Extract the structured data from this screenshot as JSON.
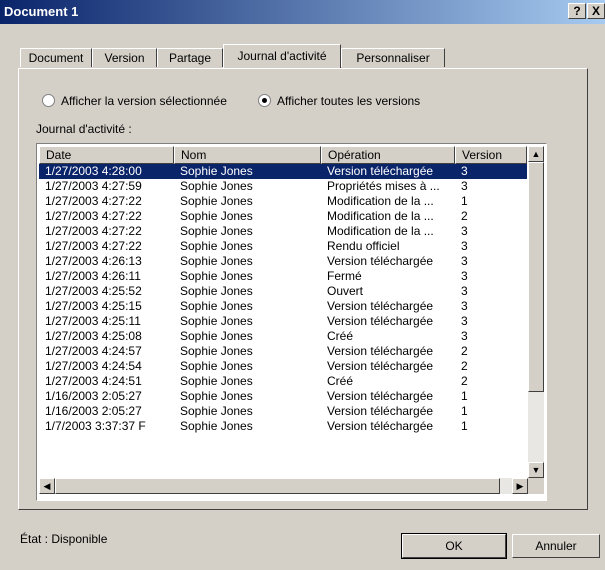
{
  "window": {
    "title": "Document 1",
    "help": "?",
    "close": "X"
  },
  "tabs": [
    "Document",
    "Version",
    "Partage",
    "Journal d'activité",
    "Personnaliser"
  ],
  "options": {
    "radio_selected": "Afficher la version sélectionnée",
    "radio_all": "Afficher toutes les versions"
  },
  "log_label": "Journal d'activité :",
  "table": {
    "columns": [
      "Date",
      "Nom",
      "Opération",
      "Version"
    ],
    "rows": [
      [
        "1/27/2003 4:28:00",
        "Sophie Jones",
        "Version téléchargée",
        "3"
      ],
      [
        "1/27/2003 4:27:59",
        "Sophie Jones",
        "Propriétés mises à ...",
        "3"
      ],
      [
        "1/27/2003 4:27:22",
        "Sophie Jones",
        "Modification de la ...",
        "1"
      ],
      [
        "1/27/2003 4:27:22",
        "Sophie Jones",
        "Modification de la ...",
        "2"
      ],
      [
        "1/27/2003 4:27:22",
        "Sophie Jones",
        "Modification de la ...",
        "3"
      ],
      [
        "1/27/2003 4:27:22",
        "Sophie Jones",
        "Rendu officiel",
        "3"
      ],
      [
        "1/27/2003 4:26:13",
        "Sophie Jones",
        "Version téléchargée",
        "3"
      ],
      [
        "1/27/2003 4:26:11",
        "Sophie Jones",
        "Fermé",
        "3"
      ],
      [
        "1/27/2003 4:25:52",
        "Sophie Jones",
        "Ouvert",
        "3"
      ],
      [
        "1/27/2003 4:25:15",
        "Sophie Jones",
        "Version téléchargée",
        "3"
      ],
      [
        "1/27/2003 4:25:11",
        "Sophie Jones",
        "Version téléchargée",
        "3"
      ],
      [
        "1/27/2003 4:25:08",
        "Sophie Jones",
        "Créé",
        "3"
      ],
      [
        "1/27/2003 4:24:57",
        "Sophie Jones",
        "Version téléchargée",
        "2"
      ],
      [
        "1/27/2003 4:24:54",
        "Sophie Jones",
        "Version téléchargée",
        "2"
      ],
      [
        "1/27/2003 4:24:51",
        "Sophie Jones",
        "Créé",
        "2"
      ],
      [
        "1/16/2003 2:05:27",
        "Sophie Jones",
        "Version téléchargée",
        "1"
      ],
      [
        "1/16/2003 2:05:27",
        "Sophie Jones",
        "Version téléchargée",
        "1"
      ],
      [
        "1/7/2003 3:37:37 F",
        "Sophie Jones",
        "Version téléchargée",
        "1"
      ]
    ]
  },
  "status": "État : Disponible",
  "buttons": {
    "ok": "OK",
    "cancel": "Annuler"
  }
}
